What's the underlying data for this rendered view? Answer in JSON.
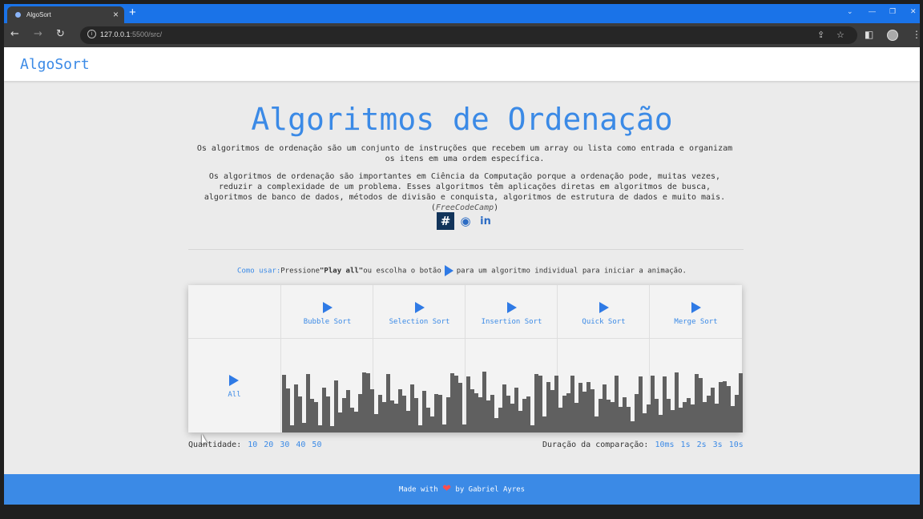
{
  "browser": {
    "tab_title": "AlgoSort",
    "url_host": "127.0.0.1",
    "url_path": ":5500/src/"
  },
  "navbar": {
    "brand": "AlgoSort"
  },
  "hero": {
    "title": "Algoritmos de Ordenação",
    "paragraph1": "Os algoritmos de ordenação são um conjunto de instruções que recebem um array ou lista como entrada e organizam os itens em uma ordem específica.",
    "paragraph2": "Os algoritmos de ordenação são importantes em Ciência da Computação porque a ordenação pode, muitas vezes, reduzir a complexidade de um problema. Esses algoritmos têm aplicações diretas em algoritmos de busca, algoritmos de banco de dados, métodos de divisão e conquista, algoritmos de estrutura de dados e muito mais.",
    "source_open": "(",
    "source": "FreeCodeCamp",
    "source_close": ")"
  },
  "howto": {
    "label": "Como usar:",
    "text1": "Pressione",
    "play_all": "\"Play all\"",
    "text2": "ou escolha o botão",
    "text3": "para um algoritmo individual para iniciar a animação."
  },
  "algorithms": [
    "Bubble Sort",
    "Selection Sort",
    "Insertion Sort",
    "Quick Sort",
    "Merge Sort"
  ],
  "play_all_label": "All",
  "bar_groups": [
    [
      85,
      65,
      10,
      71,
      53,
      14,
      86,
      49,
      45,
      10,
      66,
      53,
      9,
      77,
      29,
      51,
      62,
      36,
      31,
      57,
      88,
      87,
      63
    ],
    [
      27,
      55,
      45,
      86,
      47,
      42,
      64,
      54,
      32,
      70,
      51,
      10,
      61,
      36,
      24,
      57,
      55,
      12,
      52,
      87,
      83,
      73,
      12
    ],
    [
      82,
      64,
      58,
      52,
      89,
      47,
      55,
      21,
      36,
      70,
      54,
      42,
      66,
      32,
      49,
      53,
      11,
      86,
      84,
      23,
      74,
      62,
      83
    ],
    [
      37,
      54,
      58,
      83,
      44,
      73,
      60,
      74,
      63,
      24,
      49,
      70,
      48,
      45,
      84,
      38,
      52,
      38,
      16,
      56,
      82,
      28,
      41
    ],
    [
      84,
      49,
      26,
      82,
      49,
      33,
      88,
      37,
      45,
      51,
      41,
      86,
      80,
      45,
      54,
      66,
      42,
      74,
      75,
      68,
      39,
      55,
      87
    ]
  ],
  "quantity": {
    "label": "Quantidade:",
    "options": [
      "10",
      "20",
      "30",
      "40",
      "50"
    ]
  },
  "duration": {
    "label": "Duração da comparação:",
    "options": [
      "10ms",
      "1s",
      "2s",
      "3s",
      "10s"
    ]
  },
  "footer": {
    "made_with": "Made with",
    "by": "by Gabriel Ayres"
  },
  "colors": {
    "accent": "#3b8ae6",
    "bar": "#606060",
    "footer": "#3b8ae6"
  }
}
